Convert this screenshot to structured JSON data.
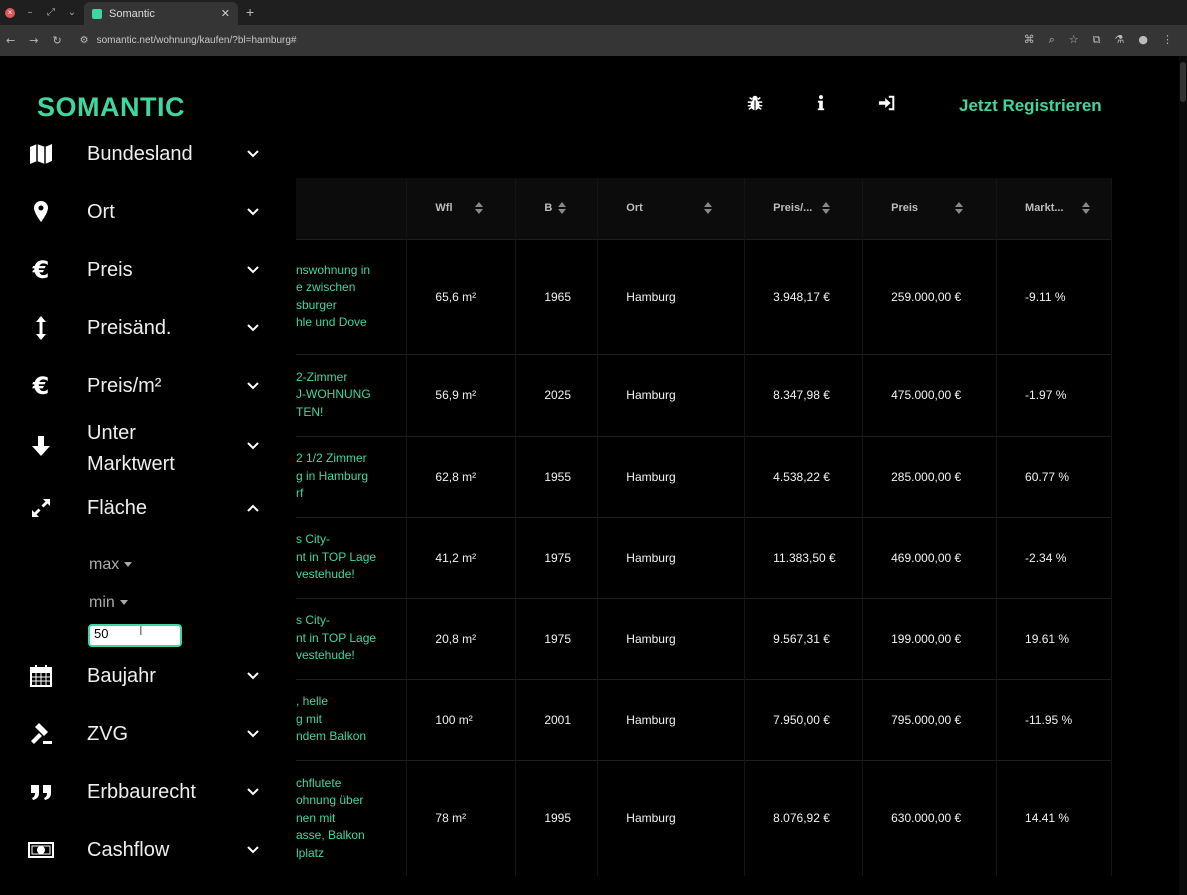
{
  "browser": {
    "tab_title": "Somantic",
    "url": "somantic.net/wohnung/kaufen/?bl=hamburg#"
  },
  "site": {
    "brand": "SOMANTIC",
    "register": "Jetzt Registrieren",
    "accent": "#3fd6a1"
  },
  "header_icons": [
    "bug-icon",
    "info-icon",
    "sign-in-icon"
  ],
  "sidebar": {
    "items": [
      {
        "label": "Bundesland",
        "icon": "map-icon"
      },
      {
        "label": "Ort",
        "icon": "map-pin-icon"
      },
      {
        "label": "Preis",
        "icon": "euro-icon"
      },
      {
        "label": "Preisänd.",
        "icon": "vertical-arrows-icon"
      },
      {
        "label": "Preis/m²",
        "icon": "euro-icon"
      },
      {
        "label": "Unter",
        "label2": "Marktwert",
        "icon": "arrow-down-icon"
      },
      {
        "label": "Fläche",
        "icon": "expand-icon"
      },
      {
        "label": "Baujahr",
        "icon": "calendar-icon"
      },
      {
        "label": "ZVG",
        "icon": "gavel-icon"
      },
      {
        "label": "Erbbaurecht",
        "icon": "quote-icon"
      },
      {
        "label": "Cashflow",
        "icon": "money-bill-icon"
      }
    ],
    "flaeche": {
      "max_label": "max",
      "min_label": "min",
      "min_value": "50"
    }
  },
  "table": {
    "headers": [
      "",
      "Wfl",
      "B",
      "Ort",
      "Preis/...",
      "Preis",
      "Markt..."
    ],
    "rows": [
      {
        "title": [
          "nswohnung in",
          "e zwischen",
          "sburger",
          "hle und Dove"
        ],
        "wfl": "65,6 m²",
        "baujahr": "1965",
        "ort": "Hamburg",
        "preis_qm": "3.948,17 €",
        "preis": "259.000,00 €",
        "markt": "-9.11 %"
      },
      {
        "title": [
          "2-Zimmer",
          "J-WOHNUNG",
          "TEN!"
        ],
        "wfl": "56,9 m²",
        "baujahr": "2025",
        "ort": "Hamburg",
        "preis_qm": "8.347,98 €",
        "preis": "475.000,00 €",
        "markt": "-1.97 %"
      },
      {
        "title": [
          "2 1/2 Zimmer",
          "g in Hamburg",
          "rf"
        ],
        "wfl": "62,8 m²",
        "baujahr": "1955",
        "ort": "Hamburg",
        "preis_qm": "4.538,22 €",
        "preis": "285.000,00 €",
        "markt": "60.77 %"
      },
      {
        "title": [
          "s City-",
          "nt in TOP Lage",
          "vestehude!"
        ],
        "wfl": "41,2 m²",
        "baujahr": "1975",
        "ort": "Hamburg",
        "preis_qm": "11.383,50 €",
        "preis": "469.000,00 €",
        "markt": "-2.34 %"
      },
      {
        "title": [
          "s City-",
          "nt in TOP Lage",
          "vestehude!"
        ],
        "wfl": "20,8 m²",
        "baujahr": "1975",
        "ort": "Hamburg",
        "preis_qm": "9.567,31 €",
        "preis": "199.000,00 €",
        "markt": "19.61 %"
      },
      {
        "title": [
          ", helle",
          "g mit",
          "ndem Balkon"
        ],
        "wfl": "100 m²",
        "baujahr": "2001",
        "ort": "Hamburg",
        "preis_qm": "7.950,00 €",
        "preis": "795.000,00 €",
        "markt": "-11.95 %"
      },
      {
        "title": [
          "chflutete",
          "ohnung über",
          "nen mit",
          "asse, Balkon",
          "lplatz"
        ],
        "wfl": "78 m²",
        "baujahr": "1995",
        "ort": "Hamburg",
        "preis_qm": "8.076,92 €",
        "preis": "630.000,00 €",
        "markt": "14.41 %"
      }
    ]
  }
}
